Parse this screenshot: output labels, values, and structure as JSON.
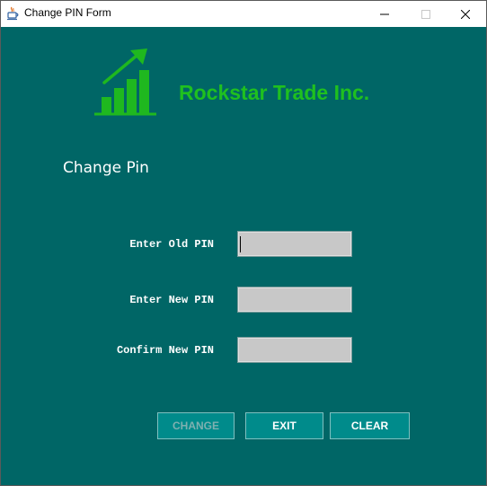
{
  "window": {
    "title": "Change PIN Form"
  },
  "header": {
    "company_name": "Rockstar Trade Inc."
  },
  "form": {
    "title": "Change Pin",
    "fields": [
      {
        "label": "Enter Old PIN",
        "value": ""
      },
      {
        "label": "Enter New PIN",
        "value": ""
      },
      {
        "label": "Confirm New PIN",
        "value": ""
      }
    ]
  },
  "buttons": {
    "change": {
      "label": "CHANGE",
      "enabled": false
    },
    "exit": {
      "label": "EXIT",
      "enabled": true
    },
    "clear": {
      "label": "CLEAR",
      "enabled": true
    }
  },
  "colors": {
    "background": "#006666",
    "brand": "#1fc01f",
    "button": "#008b8b",
    "input": "#c8c8c8"
  },
  "icons": {
    "app": "java-cup-icon",
    "logo": "growth-chart-icon"
  }
}
